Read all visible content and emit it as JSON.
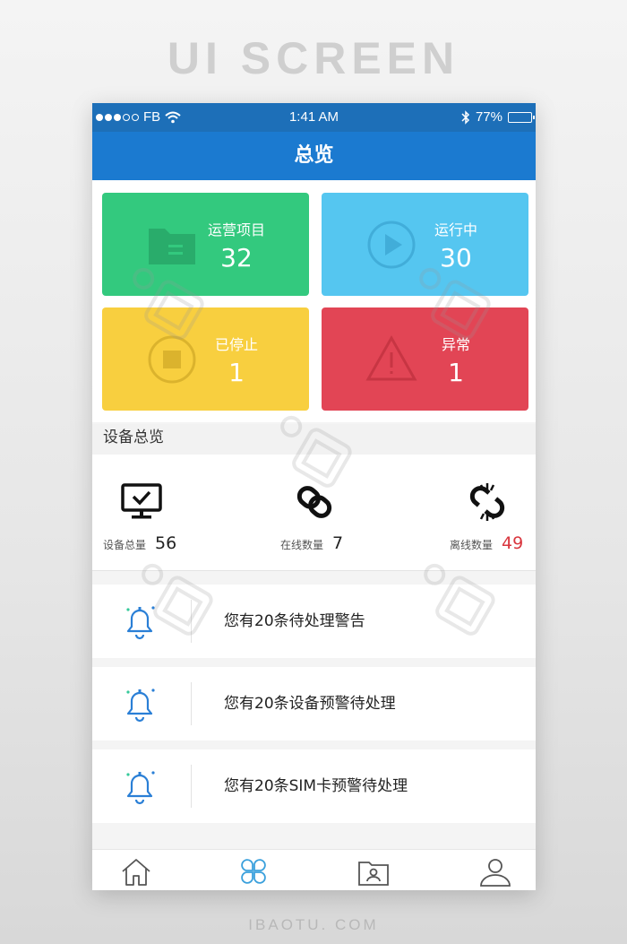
{
  "page": {
    "headline": "UI SCREEN",
    "footer": "IBAOTU. COM"
  },
  "status_bar": {
    "carrier": "FB",
    "time": "1:41 AM",
    "battery": "77%",
    "battery_level": 0.77,
    "signal_bars_filled": 3,
    "signal_bars_total": 5
  },
  "nav": {
    "title": "总览"
  },
  "tiles": [
    {
      "label": "运营项目",
      "value": "32",
      "color": "#33c97e",
      "icon": "folder-icon"
    },
    {
      "label": "运行中",
      "value": "30",
      "color": "#55c6f0",
      "icon": "play-icon"
    },
    {
      "label": "已停止",
      "value": "1",
      "color": "#f8cf3f",
      "icon": "stop-icon"
    },
    {
      "label": "异常",
      "value": "1",
      "color": "#e24555",
      "icon": "warning-icon"
    }
  ],
  "device_section": {
    "title": "设备总览",
    "items": [
      {
        "label": "设备总量",
        "value": "56",
        "icon": "monitor-check-icon"
      },
      {
        "label": "在线数量",
        "value": "7",
        "icon": "link-icon"
      },
      {
        "label": "离线数量",
        "value": "49",
        "icon": "broken-link-icon",
        "value_color": "#d9363e"
      }
    ]
  },
  "alerts": [
    {
      "text": "您有20条待处理警告",
      "icon": "bell-icon"
    },
    {
      "text": "您有20条设备预警待处理",
      "icon": "bell-icon"
    },
    {
      "text": "您有20条SIM卡预警待处理",
      "icon": "bell-icon"
    }
  ],
  "tabbar": {
    "tabs": [
      {
        "icon": "home-icon",
        "active": false
      },
      {
        "icon": "apps-icon",
        "active": true
      },
      {
        "icon": "contacts-folder-icon",
        "active": false
      },
      {
        "icon": "user-icon",
        "active": false
      }
    ],
    "active_color": "#3aa0dc",
    "inactive_color": "#555555"
  },
  "colors": {
    "status_bar": "#1d6fb8",
    "nav_bar": "#1b7ad0",
    "bell": "#2a7fd6"
  }
}
